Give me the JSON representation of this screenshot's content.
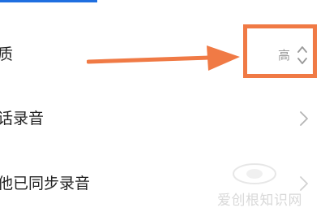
{
  "settings": {
    "rows": [
      {
        "label": "质"
      },
      {
        "label": "话录音"
      },
      {
        "label": "他已同步录音"
      }
    ],
    "quality_value": "高"
  },
  "watermark": {
    "text": "爱创根知识网"
  },
  "colors": {
    "highlight": "#f07a45",
    "arrow": "#f07a45",
    "accent": "#1f6fe0"
  },
  "icons": [
    "updown-chevron-icon",
    "chevron-right-icon",
    "annotation-arrow"
  ]
}
